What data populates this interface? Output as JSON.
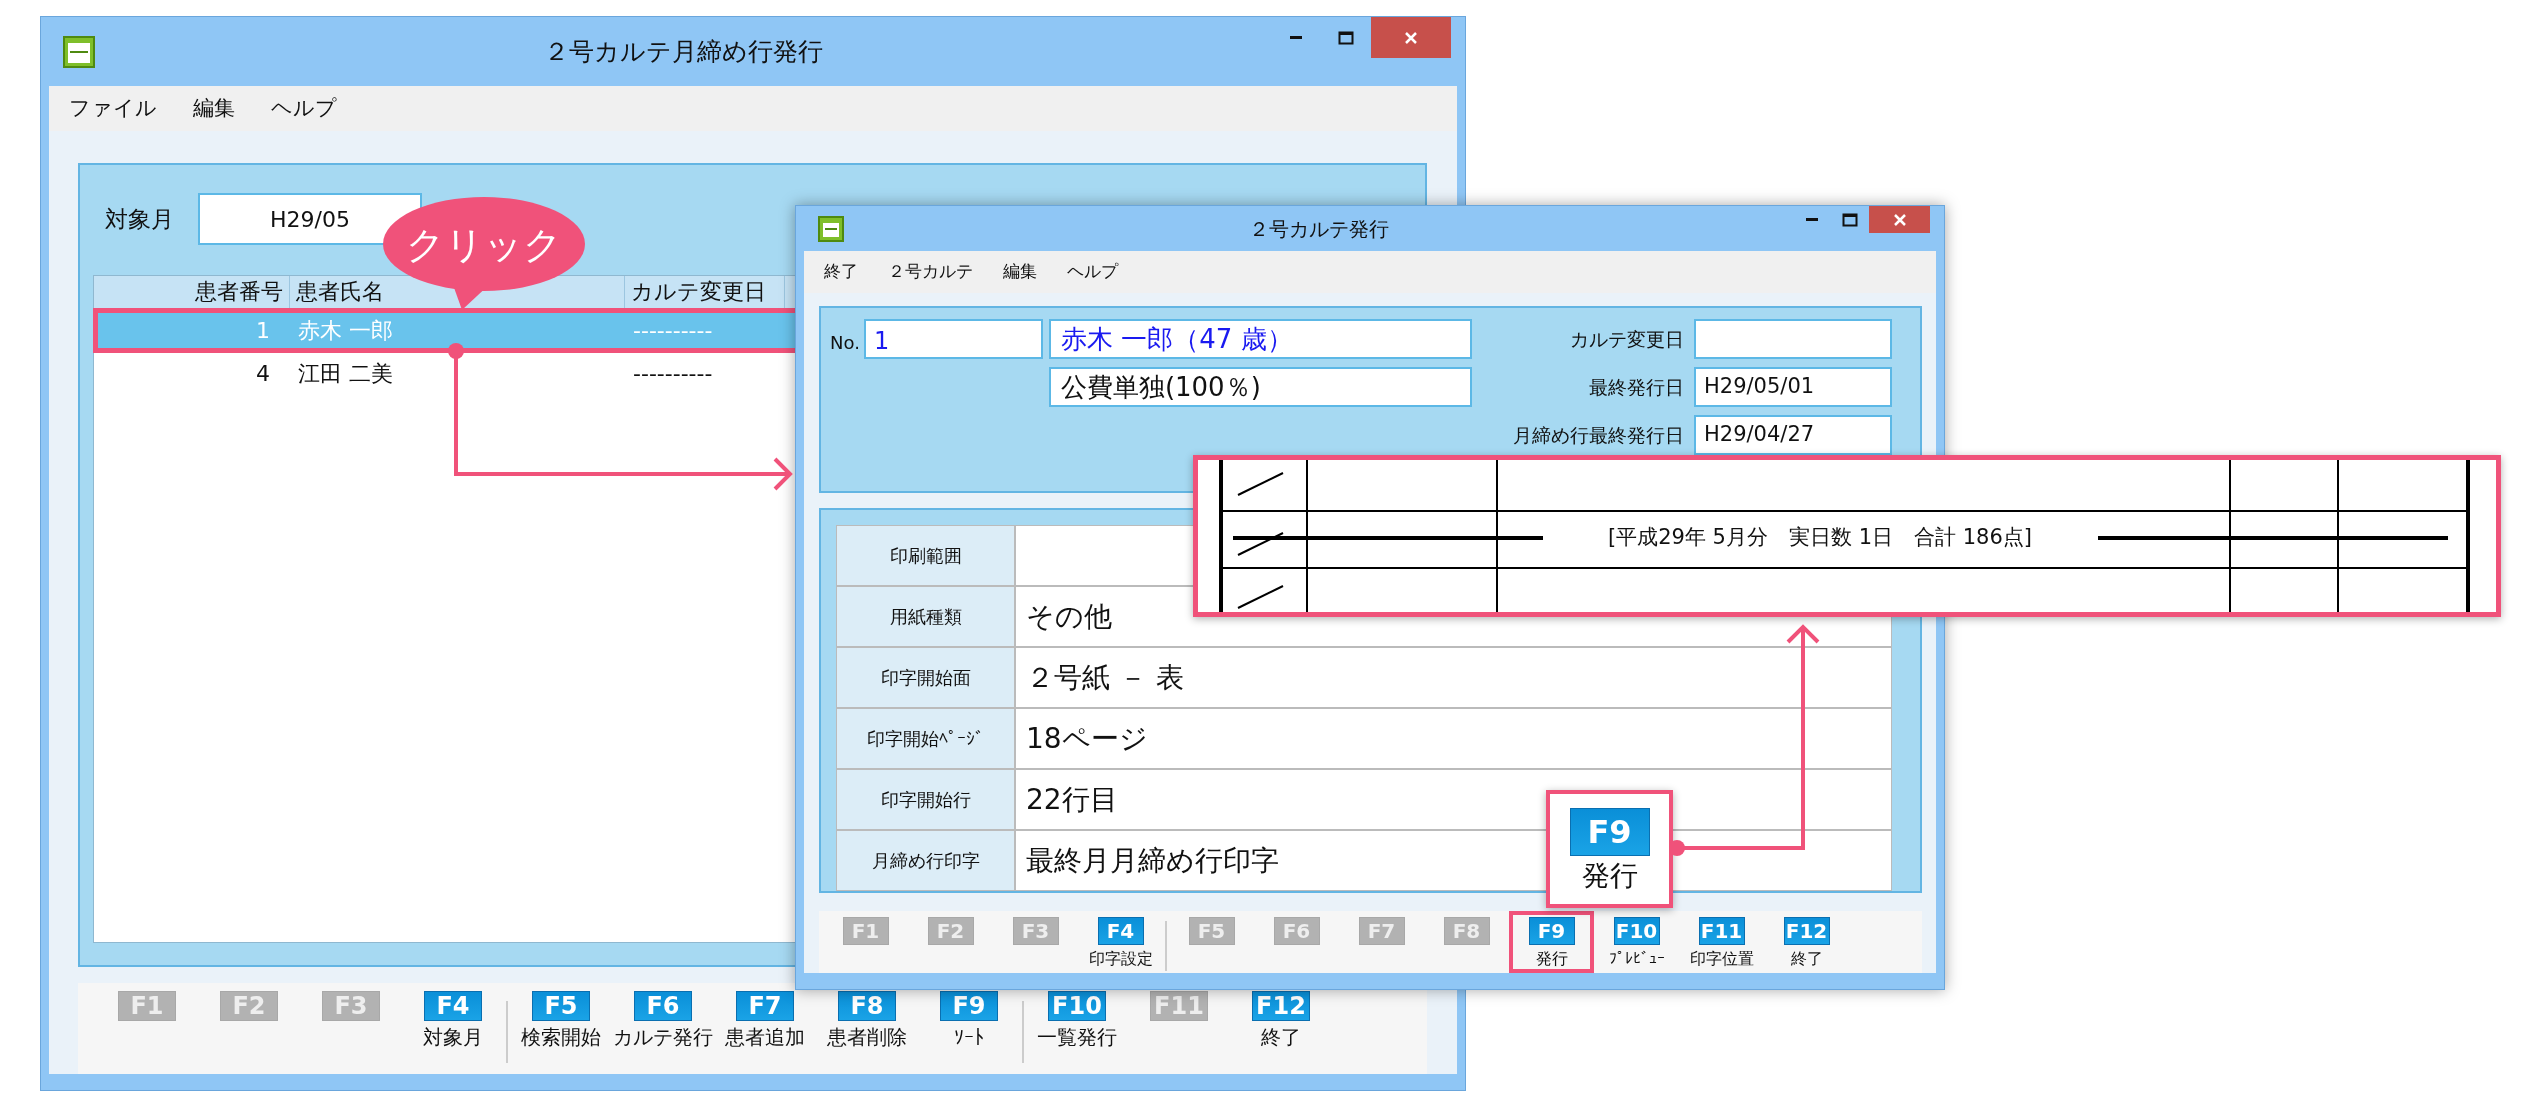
{
  "main_window": {
    "title": "２号カルテ月締め行発行",
    "menu": [
      "ファイル",
      "編集",
      "ヘルプ"
    ],
    "target_month": {
      "label": "対象月",
      "value": "H29/05"
    },
    "list": {
      "columns": [
        "患者番号",
        "患者氏名",
        "カルテ変更日"
      ],
      "rows": [
        {
          "number": "1",
          "name": "赤木 一郎",
          "changed": "----------",
          "selected": true,
          "highlighted": true
        },
        {
          "number": "4",
          "name": "江田 二美",
          "changed": "----------",
          "selected": false,
          "highlighted": false
        }
      ]
    },
    "function_keys": [
      {
        "key": "F1",
        "enabled": false
      },
      {
        "key": "F2",
        "enabled": false
      },
      {
        "key": "F3",
        "enabled": false
      },
      {
        "key": "F4",
        "label": "対象月",
        "enabled": true
      },
      {
        "key": "F5",
        "label": "検索開始",
        "enabled": true
      },
      {
        "key": "F6",
        "label": "カルテ発行",
        "enabled": true
      },
      {
        "key": "F7",
        "label": "患者追加",
        "enabled": true
      },
      {
        "key": "F8",
        "label": "患者削除",
        "enabled": true
      },
      {
        "key": "F9",
        "label": "ｿｰﾄ",
        "enabled": true
      },
      {
        "key": "F10",
        "label": "一覧発行",
        "enabled": true
      },
      {
        "key": "F11",
        "enabled": false
      },
      {
        "key": "F12",
        "label": "終了",
        "enabled": true
      }
    ]
  },
  "dialog": {
    "title": "２号カルテ発行",
    "menu": [
      "終了",
      "２号カルテ",
      "編集",
      "ヘルプ"
    ],
    "patient_no": {
      "label": "No.",
      "value": "1"
    },
    "patient_name": "赤木 一郎（47 歳）",
    "insurance": "公費単独(100％)",
    "dates": [
      {
        "label": "カルテ変更日"
      },
      {
        "label": "最終発行日",
        "value": "H29/05/01"
      },
      {
        "label": "月締め行最終発行日",
        "value": "H29/04/27"
      }
    ],
    "settings": [
      {
        "label": "印刷範囲"
      },
      {
        "label": "用紙種類",
        "value": "その他"
      },
      {
        "label": "印字開始面",
        "value": "２号紙 － 表"
      },
      {
        "label": "印字開始ﾍﾟｰｼﾞ",
        "value": "18ページ"
      },
      {
        "label": "印字開始行",
        "value": "22行目"
      },
      {
        "label": "月締め行印字",
        "value": "最終月月締め行印字"
      }
    ],
    "function_keys": [
      {
        "key": "F1",
        "enabled": false,
        "highlighted": false
      },
      {
        "key": "F2",
        "enabled": false,
        "highlighted": false
      },
      {
        "key": "F3",
        "enabled": false,
        "highlighted": false
      },
      {
        "key": "F4",
        "label": "印字設定",
        "enabled": true,
        "highlighted": false
      },
      {
        "key": "F5",
        "enabled": false,
        "highlighted": false
      },
      {
        "key": "F6",
        "enabled": false,
        "highlighted": false
      },
      {
        "key": "F7",
        "enabled": false,
        "highlighted": false
      },
      {
        "key": "F8",
        "enabled": false,
        "highlighted": false
      },
      {
        "key": "F9",
        "label": "発行",
        "enabled": true,
        "highlighted": true
      },
      {
        "key": "F10",
        "label": "ﾌﾟﾚﾋﾞｭｰ",
        "enabled": true,
        "highlighted": false
      },
      {
        "key": "F11",
        "label": "印字位置",
        "enabled": true,
        "highlighted": false
      },
      {
        "key": "F12",
        "label": "終了",
        "enabled": true,
        "highlighted": false
      }
    ]
  },
  "click_callout": "クリック",
  "key_callout": {
    "key": "F9",
    "label": "発行"
  },
  "print_preview": {
    "summary": "[平成29年 5月分　実日数 1日　合計 186点]"
  }
}
